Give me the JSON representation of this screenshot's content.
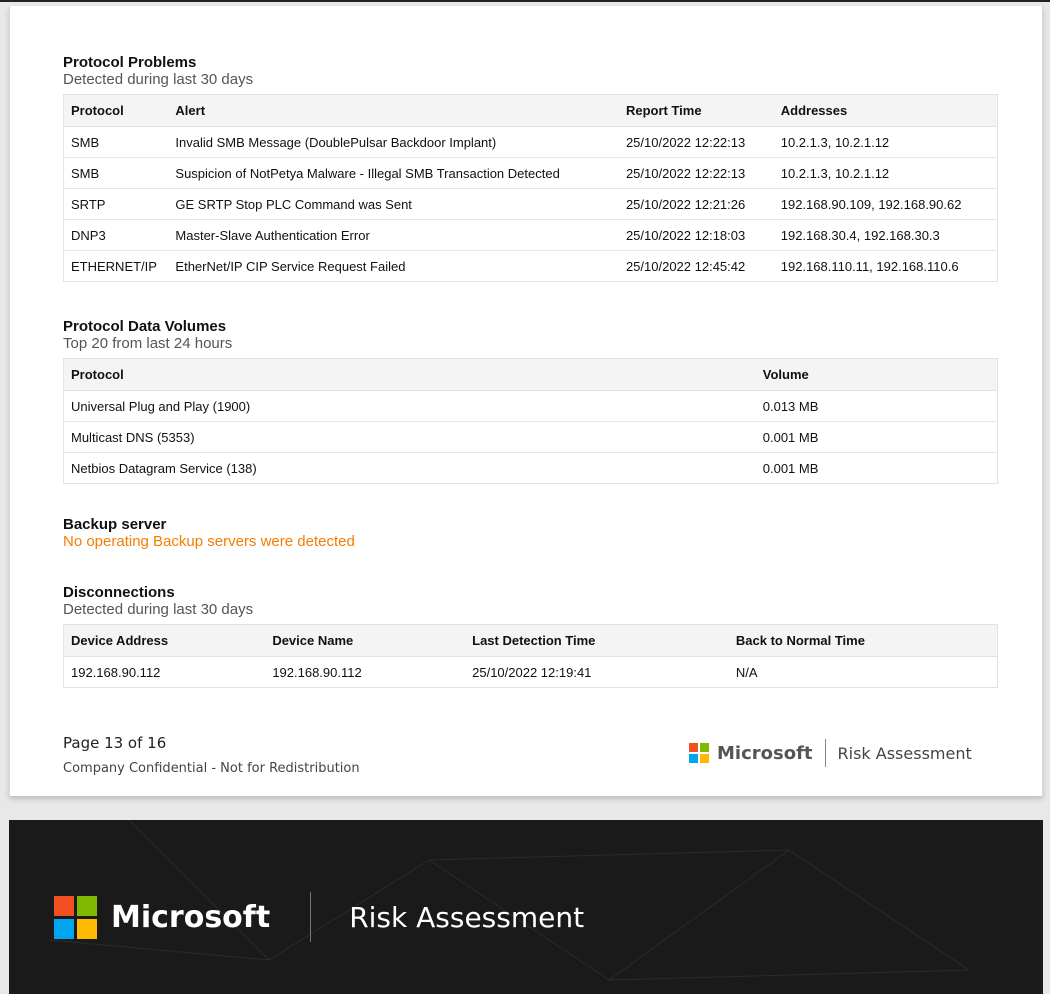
{
  "protocol_problems": {
    "title": "Protocol Problems",
    "subtitle": "Detected during last 30 days",
    "headers": [
      "Protocol",
      "Alert",
      "Report Time",
      "Addresses"
    ],
    "rows": [
      [
        "SMB",
        "Invalid SMB Message (DoublePulsar Backdoor Implant)",
        "25/10/2022 12:22:13",
        "10.2.1.3, 10.2.1.12"
      ],
      [
        "SMB",
        "Suspicion of NotPetya Malware - Illegal SMB Transaction Detected",
        "25/10/2022 12:22:13",
        "10.2.1.3, 10.2.1.12"
      ],
      [
        "SRTP",
        "GE SRTP Stop PLC Command was Sent",
        "25/10/2022 12:21:26",
        "192.168.90.109, 192.168.90.62"
      ],
      [
        "DNP3",
        "Master-Slave Authentication Error",
        "25/10/2022 12:18:03",
        "192.168.30.4, 192.168.30.3"
      ],
      [
        "ETHERNET/IP",
        "EtherNet/IP CIP Service Request Failed",
        "25/10/2022 12:45:42",
        "192.168.110.11, 192.168.110.6"
      ]
    ]
  },
  "protocol_data_volumes": {
    "title": "Protocol Data Volumes",
    "subtitle": "Top 20 from last 24 hours",
    "headers": [
      "Protocol",
      "Volume"
    ],
    "rows": [
      [
        "Universal Plug and Play (1900)",
        "0.013 MB"
      ],
      [
        "Multicast DNS (5353)",
        "0.001 MB"
      ],
      [
        "Netbios Datagram Service (138)",
        "0.001 MB"
      ]
    ]
  },
  "backup_server": {
    "title": "Backup server",
    "message": "No operating Backup servers were detected",
    "message_color": "#f57c00"
  },
  "disconnections": {
    "title": "Disconnections",
    "subtitle": "Detected during last 30 days",
    "headers": [
      "Device Address",
      "Device Name",
      "Last Detection Time",
      "Back to Normal Time"
    ],
    "rows": [
      [
        "192.168.90.112",
        "192.168.90.112",
        "25/10/2022 12:19:41",
        "N/A"
      ]
    ]
  },
  "footer": {
    "page": "Page 13 of 16",
    "confidential": "Company Confidential - Not for Redistribution",
    "brand": "Microsoft",
    "product": "Risk Assessment"
  },
  "cover": {
    "brand": "Microsoft",
    "product": "Risk Assessment"
  },
  "logo_colors": [
    "#f25022",
    "#7fba00",
    "#00a4ef",
    "#ffb900"
  ]
}
